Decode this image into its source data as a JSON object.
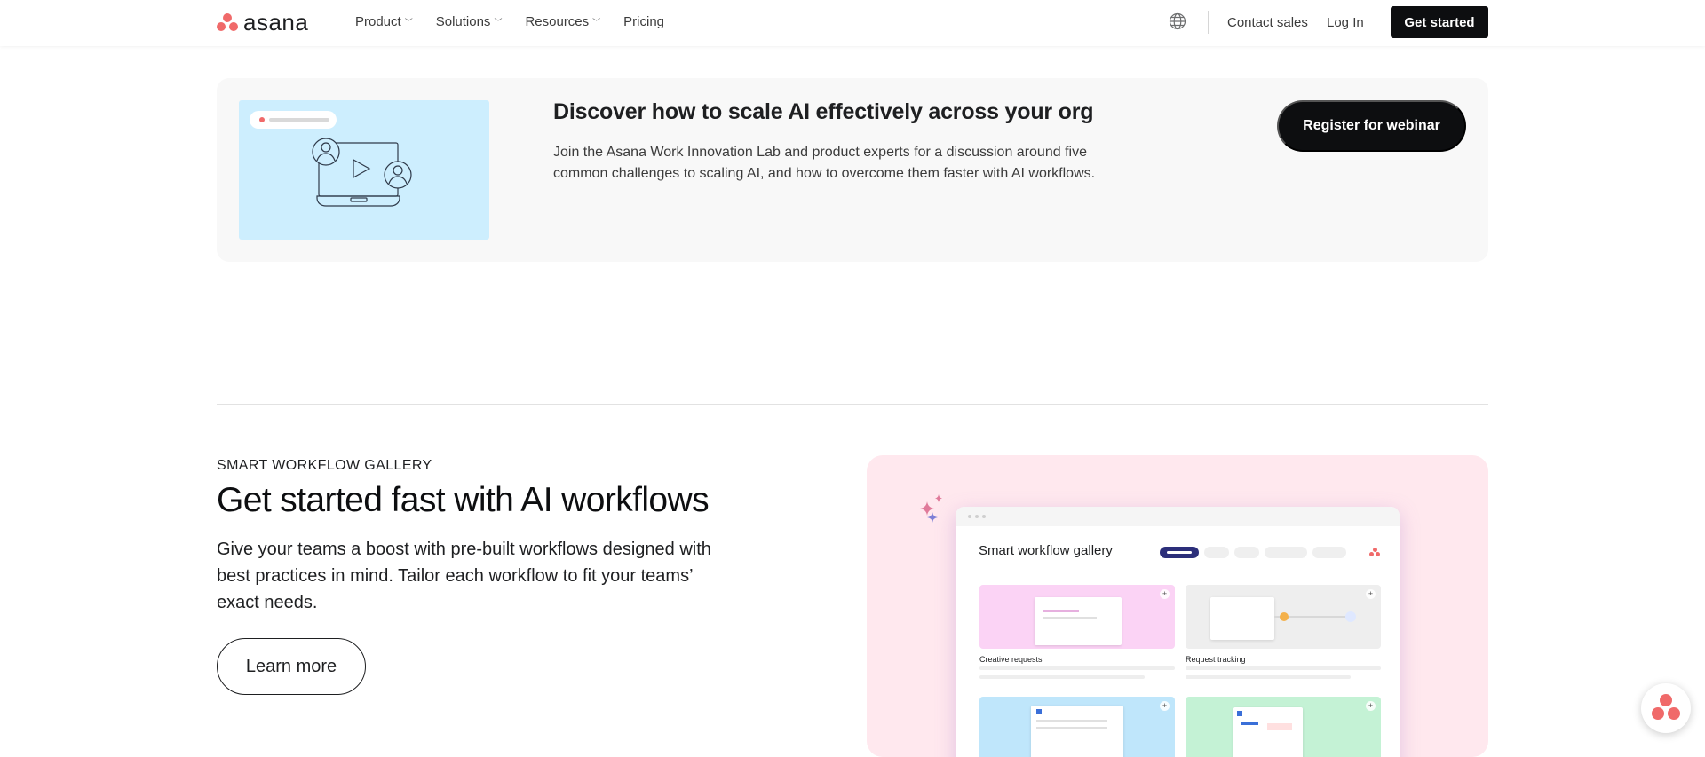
{
  "header": {
    "logo_text": "asana",
    "nav": [
      {
        "label": "Product",
        "dropdown": true
      },
      {
        "label": "Solutions",
        "dropdown": true
      },
      {
        "label": "Resources",
        "dropdown": true
      },
      {
        "label": "Pricing",
        "dropdown": false
      }
    ],
    "contact_sales": "Contact sales",
    "log_in": "Log In",
    "get_started": "Get started"
  },
  "banner": {
    "title": "Discover how to scale AI effectively across your org",
    "description": "Join the Asana Work Innovation Lab and product experts for a discussion around five common challenges to scaling AI, and how to overcome them faster with AI workflows.",
    "cta": "Register for webinar"
  },
  "workflow": {
    "eyebrow": "SMART WORKFLOW GALLERY",
    "heading": "Get started fast with AI workflows",
    "body": "Give your teams a boost with pre-built workflows designed with best practices in mind. Tailor each workflow to fit your teams’ exact needs.",
    "cta": "Learn more",
    "mock": {
      "title": "Smart workflow gallery",
      "cards": [
        {
          "label": "Creative requests"
        },
        {
          "label": "Request tracking"
        },
        {
          "label": ""
        },
        {
          "label": ""
        }
      ]
    }
  },
  "colors": {
    "brand_coral": "#f06a6a",
    "dark": "#0d0e10",
    "banner_bg": "#f8f8f8",
    "thumb_bg": "#cdeefe",
    "visual_bg": "#ffe8ee",
    "pill_active": "#2c2f7a"
  },
  "icons": {
    "globe": "globe-icon",
    "chevron": "chevron-down-icon",
    "sparkle": "sparkle-icon",
    "help": "asana-help-icon"
  }
}
